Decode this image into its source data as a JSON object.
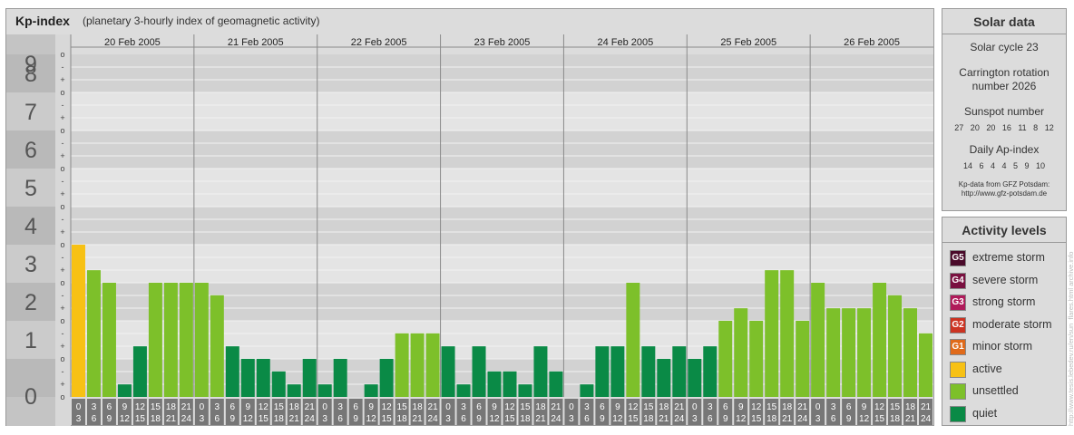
{
  "header": {
    "title": "Kp-index",
    "subtitle": "(planetary 3-hourly index of geomagnetic activity)"
  },
  "solar": {
    "title": "Solar data",
    "cycle": "Solar cycle 23",
    "carrington_1": "Carrington rotation",
    "carrington_2": "number 2026",
    "sunspot_label": "Sunspot number",
    "sunspot_values": "27 20 20 16 11 8 12",
    "ap_label": "Daily Ap-index",
    "ap_values": "14 6 4 4 5 9 10",
    "source_1": "Kp-data from GFZ Potsdam:",
    "source_2": "http://www.gfz-potsdam.de"
  },
  "activity": {
    "title": "Activity levels",
    "levels": [
      {
        "code": "G5",
        "label": "extreme storm",
        "color": "#4a0a2a"
      },
      {
        "code": "G4",
        "label": "severe storm",
        "color": "#7a1040"
      },
      {
        "code": "G3",
        "label": "strong storm",
        "color": "#b01a5a"
      },
      {
        "code": "G2",
        "label": "moderate storm",
        "color": "#cc3322"
      },
      {
        "code": "G1",
        "label": "minor storm",
        "color": "#e06a1a"
      },
      {
        "code": "",
        "label": "active",
        "color": "#f7c114"
      },
      {
        "code": "",
        "label": "unsettled",
        "color": "#7dc02a"
      },
      {
        "code": "",
        "label": "quiet",
        "color": "#0a8a46"
      }
    ]
  },
  "credit": "http://www.tesis.lebedev.ru/en/sun_flares.html  archive.info",
  "chart_data": {
    "type": "bar",
    "title": "Kp-index",
    "subtitle": "(planetary 3-hourly index of geomagnetic activity)",
    "ylim": [
      0,
      9
    ],
    "y_ticks": [
      "0",
      "1",
      "2",
      "3",
      "4",
      "5",
      "6",
      "7",
      "8",
      "9"
    ],
    "sub_ticks": [
      "-",
      "o",
      "+"
    ],
    "days": [
      "20 Feb 2005",
      "21 Feb 2005",
      "22 Feb 2005",
      "23 Feb 2005",
      "24 Feb 2005",
      "25 Feb 2005",
      "26 Feb 2005"
    ],
    "hour_labels_top": [
      "0",
      "3",
      "6",
      "9",
      "12",
      "15",
      "18",
      "21"
    ],
    "hour_labels_bottom": [
      "3",
      "6",
      "9",
      "12",
      "15",
      "18",
      "21",
      "24"
    ],
    "values": [
      4.0,
      3.33,
      3.0,
      0.33,
      1.33,
      3.0,
      3.0,
      3.0,
      3.0,
      2.67,
      1.33,
      1.0,
      1.0,
      0.67,
      0.33,
      1.0,
      0.33,
      1.0,
      0.0,
      0.33,
      1.0,
      1.67,
      1.67,
      1.67,
      1.33,
      0.33,
      1.33,
      0.67,
      0.67,
      0.33,
      1.33,
      0.67,
      0.0,
      0.33,
      1.33,
      1.33,
      3.0,
      1.33,
      1.0,
      1.33,
      1.0,
      1.33,
      2.0,
      2.33,
      2.0,
      3.33,
      3.33,
      2.0,
      3.0,
      2.33,
      2.33,
      2.33,
      3.0,
      2.67,
      2.33,
      1.67
    ],
    "legend": [
      "active",
      "unsettled",
      "quiet"
    ],
    "colors": {
      "active": "#f7c114",
      "unsettled": "#7dc02a",
      "quiet": "#0a8a46"
    },
    "grid": true
  }
}
